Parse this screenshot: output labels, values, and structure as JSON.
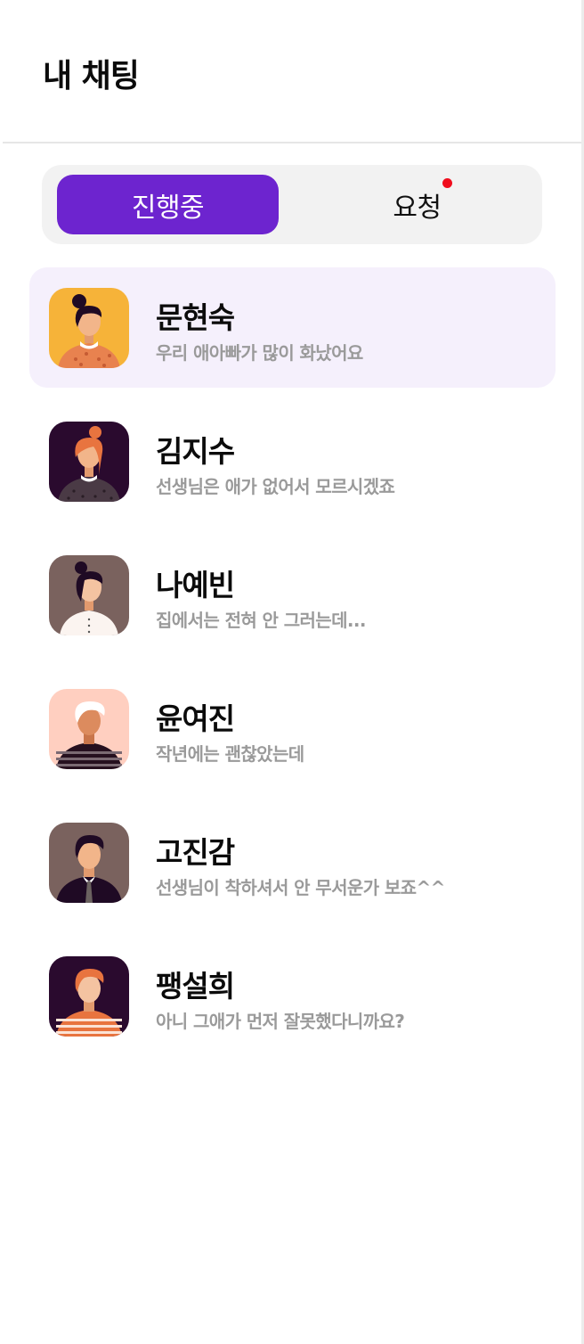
{
  "header": {
    "title": "내 채팅"
  },
  "tabs": [
    {
      "label": "진행중",
      "active": true
    },
    {
      "label": "요청",
      "active": false,
      "has_notification": true
    }
  ],
  "colors": {
    "accent": "#6d24cf",
    "notification": "#f00d1d",
    "selected_row": "#f5f0fc",
    "preview_text": "#9a9a9a"
  },
  "chats": [
    {
      "name": "문현숙",
      "preview": "우리 애아빠가 많이 화났어요",
      "selected": true,
      "avatar": "woman-bun-orange-bg"
    },
    {
      "name": "김지수",
      "preview": "선생님은 애가 없어서 모르시겠죠",
      "selected": false,
      "avatar": "woman-redhair-dark-bg"
    },
    {
      "name": "나예빈",
      "preview": "집에서는 전혀 안 그러는데...",
      "selected": false,
      "avatar": "woman-bun-taupe-bg"
    },
    {
      "name": "윤여진",
      "preview": "작년에는 괜찮았는데",
      "selected": false,
      "avatar": "man-whitehair-pink-bg"
    },
    {
      "name": "고진감",
      "preview": "선생님이 착하셔서 안 무서운가 보죠^^",
      "selected": false,
      "avatar": "man-tie-taupe-bg"
    },
    {
      "name": "팽설희",
      "preview": "아니 그애가 먼저 잘못했다니까요?",
      "selected": false,
      "avatar": "man-redhair-dark-bg"
    }
  ]
}
